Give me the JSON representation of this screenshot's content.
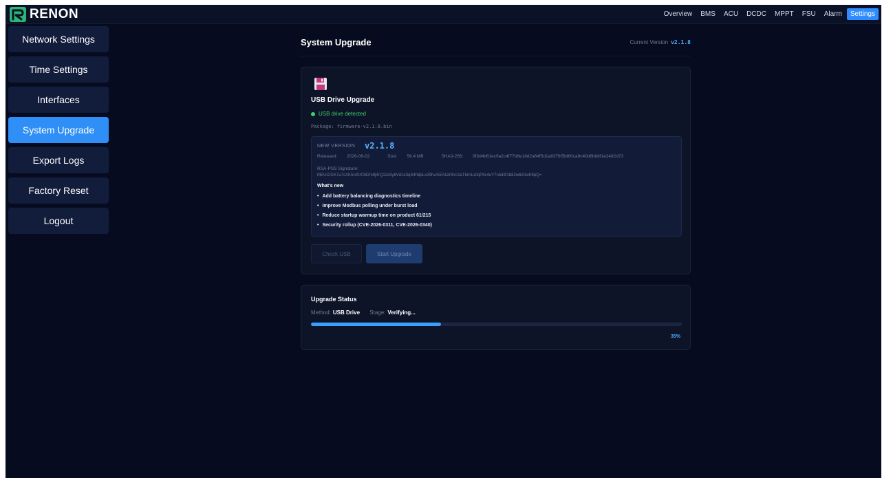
{
  "app": {
    "brand": "RENON"
  },
  "nav": {
    "items": [
      "Overview",
      "BMS",
      "ACU",
      "DCDC",
      "MPPT",
      "FSU",
      "Alarm",
      "Settings"
    ],
    "active": "Settings"
  },
  "sidebar": {
    "items": [
      "Network Settings",
      "Time Settings",
      "Interfaces",
      "System Upgrade",
      "Export Logs",
      "Factory Reset",
      "Logout"
    ],
    "active": "System Upgrade"
  },
  "page": {
    "title": "System Upgrade",
    "current_version_label": "Current Version",
    "current_version": "v2.1.8"
  },
  "usb": {
    "icon": "floppy-disk-icon",
    "title": "USB Drive Upgrade",
    "detected": "USB drive detected",
    "package_label": "Package:",
    "package": "firmware-v2.1.8.bin",
    "new_version_label": "NEW VERSION",
    "new_version": "v2.1.8",
    "released_label": "Released:",
    "released": "2026-06-02",
    "size_label": "Size:",
    "size": "58.4 MB",
    "sha_label": "SHA3-256:",
    "sha": "8f3d4b61ec9a2c4f77b8e18d2a64f5d1a8376f5b8f0ca9c40d6bb8f1e2482d73",
    "sig_label": "RSA-PSS Signature:",
    "signature": "MEUCIGX7u7sXK5rdSX082m9j4rQ12c8y6Vd1e3qS4h8pLx29hvAiEAk2r9Vc3aT6m1o0qP9c4uY7n5d3f1b82w6z0e4r8pQ=",
    "whats_new_label": "What's new",
    "changes": [
      "Add battery balancing diagnostics timeline",
      "Improve Modbus polling under burst load",
      "Reduce startup warmup time on product 61/215",
      "Security rollup (CVE-2026-0311, CVE-2026-0340)"
    ],
    "check_button": "Check USB",
    "start_button": "Start Upgrade"
  },
  "status": {
    "title": "Upgrade Status",
    "method_label": "Method:",
    "method": "USB Drive",
    "stage_label": "Stage:",
    "stage": "Verifying...",
    "progress": 35,
    "progress_text": "35%"
  },
  "colors": {
    "accent": "#2e8cff",
    "background": "#070b1f",
    "success": "#3fcf6a"
  }
}
